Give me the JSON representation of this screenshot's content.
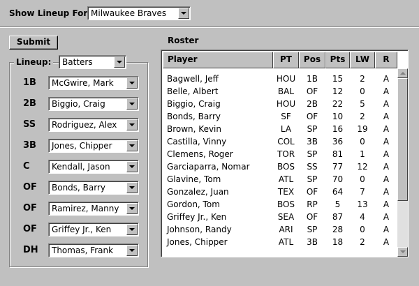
{
  "header": {
    "show_lineup_label": "Show Lineup For:",
    "team_selected": "Milwaukee Braves"
  },
  "controls": {
    "submit_label": "Submit",
    "lineup_label": "Lineup:",
    "lineup_type": "Batters"
  },
  "lineup": [
    {
      "pos": "1B",
      "player": "McGwire, Mark"
    },
    {
      "pos": "2B",
      "player": "Biggio, Craig"
    },
    {
      "pos": "SS",
      "player": "Rodriguez, Alex"
    },
    {
      "pos": "3B",
      "player": "Jones, Chipper"
    },
    {
      "pos": "C",
      "player": "Kendall, Jason"
    },
    {
      "pos": "OF",
      "player": "Bonds, Barry"
    },
    {
      "pos": "OF",
      "player": "Ramirez, Manny"
    },
    {
      "pos": "OF",
      "player": "Griffey Jr., Ken"
    },
    {
      "pos": "DH",
      "player": "Thomas, Frank"
    }
  ],
  "roster": {
    "title": "Roster",
    "columns": [
      "Player",
      "PT",
      "Pos",
      "Pts",
      "LW",
      "R"
    ],
    "rows": [
      [
        "Bagwell, Jeff",
        "HOU",
        "1B",
        "15",
        "2",
        "A"
      ],
      [
        "Belle, Albert",
        "BAL",
        "OF",
        "12",
        "0",
        "A"
      ],
      [
        "Biggio, Craig",
        "HOU",
        "2B",
        "22",
        "5",
        "A"
      ],
      [
        "Bonds, Barry",
        "SF",
        "OF",
        "10",
        "2",
        "A"
      ],
      [
        "Brown, Kevin",
        "LA",
        "SP",
        "16",
        "19",
        "A"
      ],
      [
        "Castilla, Vinny",
        "COL",
        "3B",
        "36",
        "0",
        "A"
      ],
      [
        "Clemens, Roger",
        "TOR",
        "SP",
        "81",
        "1",
        "A"
      ],
      [
        "Garciaparra, Nomar",
        "BOS",
        "SS",
        "77",
        "12",
        "A"
      ],
      [
        "Glavine, Tom",
        "ATL",
        "SP",
        "70",
        "0",
        "A"
      ],
      [
        "Gonzalez, Juan",
        "TEX",
        "OF",
        "64",
        "7",
        "A"
      ],
      [
        "Gordon, Tom",
        "BOS",
        "RP",
        "5",
        "13",
        "A"
      ],
      [
        "Griffey Jr., Ken",
        "SEA",
        "OF",
        "87",
        "4",
        "A"
      ],
      [
        "Johnson, Randy",
        "ARI",
        "SP",
        "28",
        "0",
        "A"
      ],
      [
        "Jones, Chipper",
        "ATL",
        "3B",
        "18",
        "2",
        "A"
      ]
    ]
  }
}
